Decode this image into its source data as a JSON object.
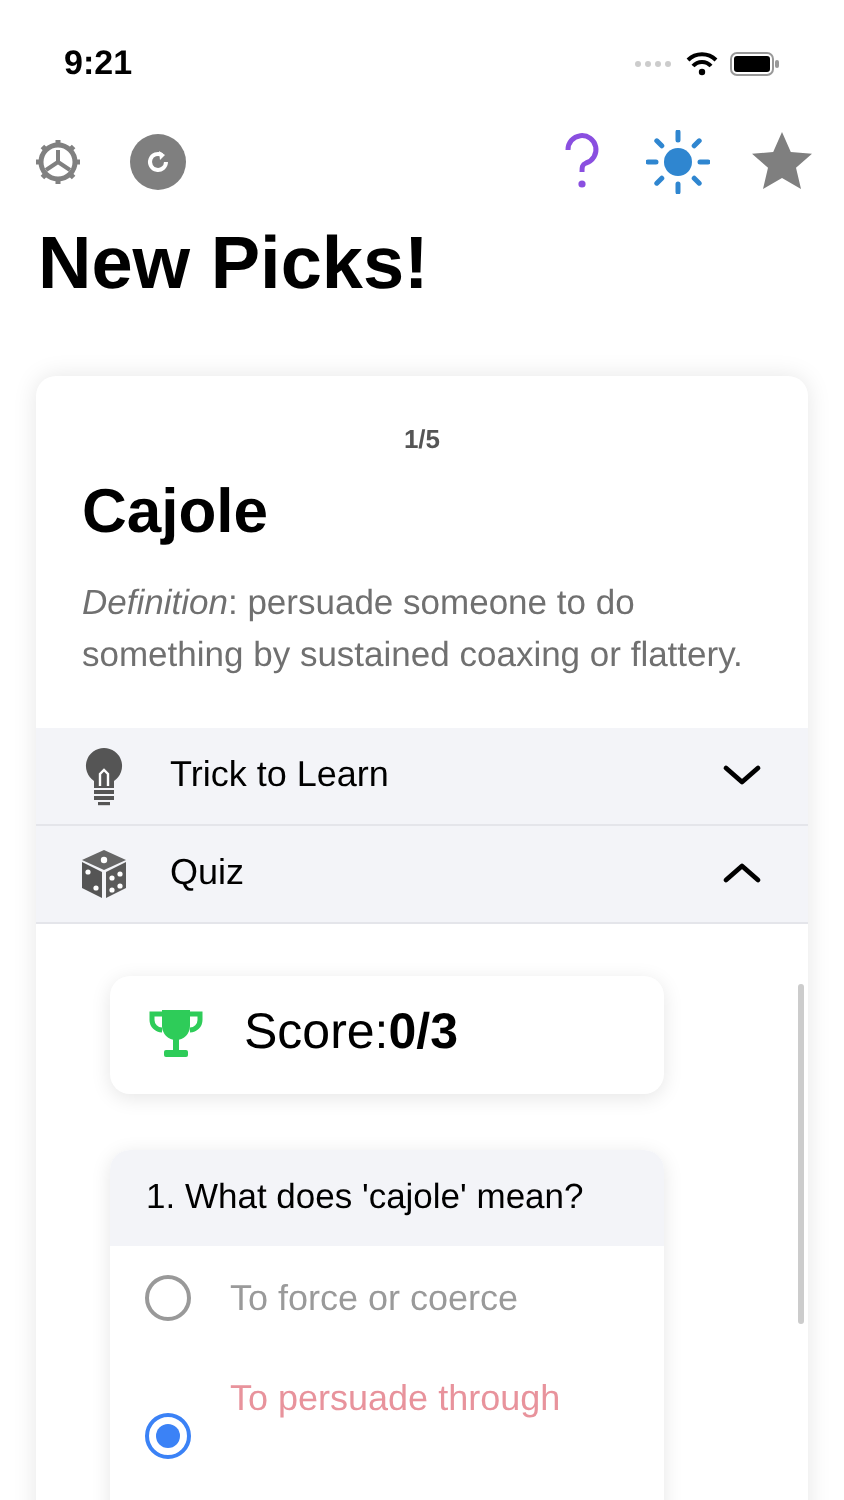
{
  "status_bar": {
    "time": "9:21"
  },
  "title": "New Picks!",
  "card": {
    "counter": "1/5",
    "word": "Cajole",
    "definition": "*Definition*: persuade someone to do something by sustained coaxing or flattery.",
    "sections": [
      {
        "kind": "trick",
        "label": "Trick to Learn",
        "expanded": false
      },
      {
        "kind": "quiz",
        "label": "Quiz",
        "expanded": true
      }
    ]
  },
  "quiz": {
    "score": "Score:**0/3**",
    "question": "1. What does 'cajole' mean?",
    "options": [
      {
        "label": "To force or coerce",
        "selected": false
      },
      {
        "label": "To persuade through",
        "selected": true
      }
    ]
  }
}
